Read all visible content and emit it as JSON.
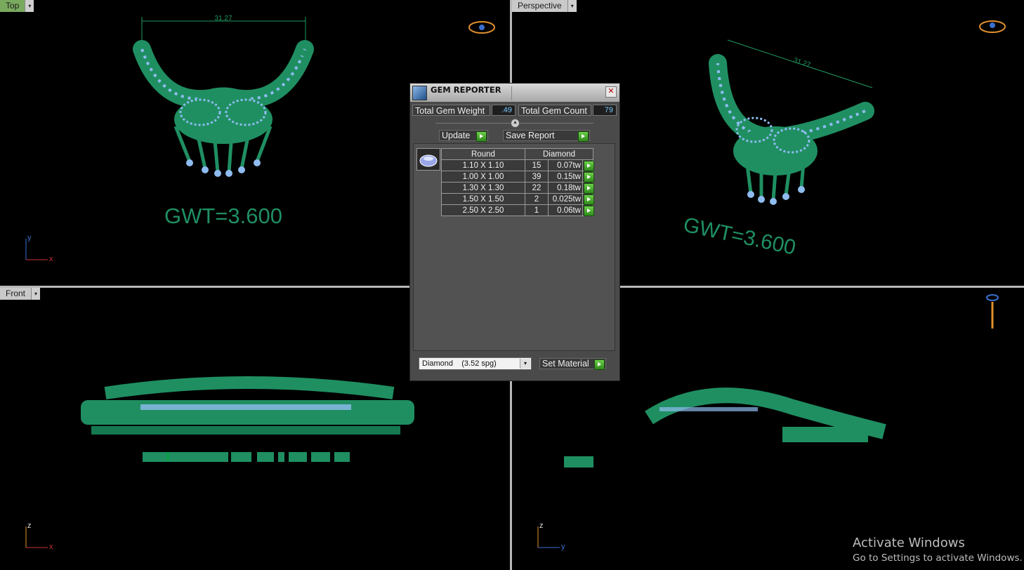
{
  "viewports": {
    "top": {
      "label": "Top",
      "dimension": "31.27",
      "annotation": "GWT=3.600",
      "axis_v": "y",
      "axis_h": "x"
    },
    "perspective": {
      "label": "Perspective",
      "dimension": "31.27",
      "annotation": "GWT=3.600"
    },
    "front": {
      "label": "Front",
      "axis_v": "z",
      "axis_h": "x"
    },
    "right": {
      "axis_v": "z",
      "axis_h": "y"
    },
    "dropdown_glyph": "▾"
  },
  "gem_reporter": {
    "title": "GEM REPORTER",
    "close_glyph": "✕",
    "total_gem_weight_label": "Total Gem Weight",
    "total_gem_weight_value": ".49",
    "total_gem_count_label": "Total Gem Count",
    "total_gem_count_value": "79",
    "update_label": "Update",
    "save_report_label": "Save Report",
    "table": {
      "headers": [
        "Round",
        "Diamond"
      ],
      "rows": [
        {
          "size": "1.10 X 1.10",
          "count": "15",
          "weight": "0.07tw"
        },
        {
          "size": "1.00 X 1.00",
          "count": "39",
          "weight": "0.15tw"
        },
        {
          "size": "1.30 X 1.30",
          "count": "22",
          "weight": "0.18tw"
        },
        {
          "size": "1.50 X 1.50",
          "count": "2",
          "weight": "0.025tw"
        },
        {
          "size": "2.50 X 2.50",
          "count": "1",
          "weight": "0.06tw"
        }
      ]
    },
    "material_value": "Diamond    (3.52 spg)",
    "set_material_label": "Set Material"
  },
  "watermark": {
    "line1": "Activate Windows",
    "line2": "Go to Settings to activate Windows."
  },
  "colors": {
    "metal": "#1f8f62",
    "gem": "#8fbcf0",
    "label_green": "#7aaa5e"
  }
}
